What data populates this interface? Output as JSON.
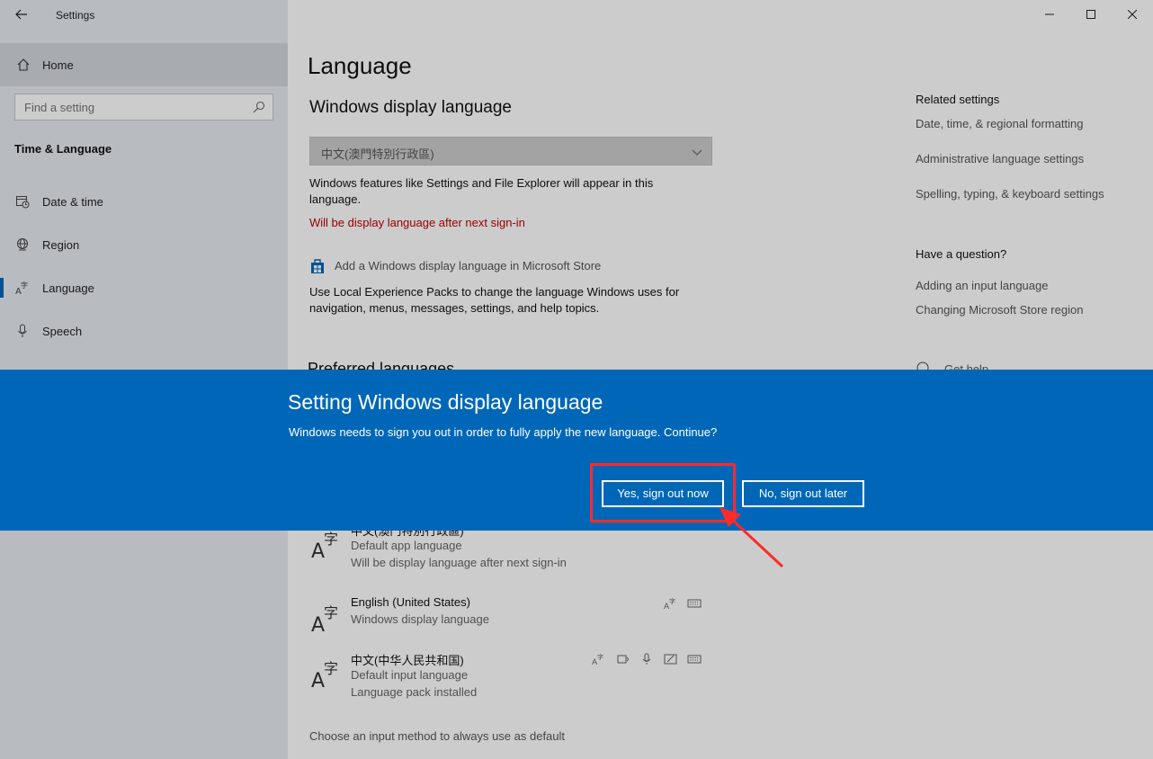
{
  "window": {
    "app_title": "Settings"
  },
  "sidebar": {
    "home_label": "Home",
    "search_placeholder": "Find a setting",
    "section_title": "Time & Language",
    "items": [
      {
        "label": "Date & time",
        "icon": "calendar-clock-icon"
      },
      {
        "label": "Region",
        "icon": "globe-icon"
      },
      {
        "label": "Language",
        "icon": "language-icon",
        "active": true
      },
      {
        "label": "Speech",
        "icon": "microphone-icon"
      }
    ]
  },
  "main": {
    "title": "Language",
    "display_language": {
      "heading": "Windows display language",
      "selected": "中文(澳門特別行政區)",
      "description": "Windows features like Settings and File Explorer will appear in this language.",
      "warning": "Will be display language after next sign-in",
      "store_link": "Add a Windows display language in Microsoft Store",
      "lxp_description": "Use Local Experience Packs to change the language Windows uses for navigation, menus, messages, settings, and help topics."
    },
    "preferred_heading": "Preferred languages",
    "languages": [
      {
        "name": "中文(澳門特別行政區)",
        "sub1": "Default app language",
        "sub2": "Will be display language after next sign-in"
      },
      {
        "name": "English (United States)",
        "sub1": "Windows display language",
        "sub2": ""
      },
      {
        "name": "中文(中华人民共和国)",
        "sub1": "Default input language",
        "sub2": "Language pack installed"
      }
    ],
    "choose_input": "Choose an input method to always use as default"
  },
  "related": {
    "heading": "Related settings",
    "links": [
      "Date, time, & regional formatting",
      "Administrative language settings",
      "Spelling, typing, & keyboard settings"
    ],
    "question_heading": "Have a question?",
    "question_links": [
      "Adding an input language",
      "Changing Microsoft Store region"
    ],
    "get_help": "Get help"
  },
  "modal": {
    "title": "Setting Windows display language",
    "message": "Windows needs to sign you out in order to fully apply the new language. Continue?",
    "yes_label": "Yes, sign out now",
    "no_label": "No, sign out later"
  },
  "colors": {
    "accent": "#0067b8",
    "warning": "#c00000",
    "annotation": "#ff2a2a"
  }
}
